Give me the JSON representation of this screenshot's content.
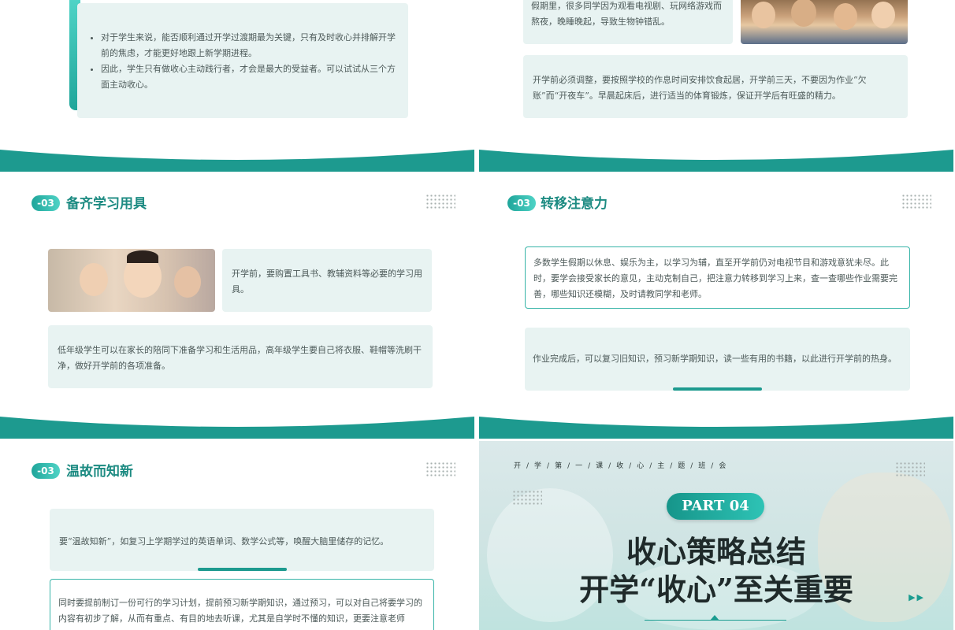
{
  "slide1": {
    "bullets": [
      "对于学生来说，能否顺利通过开学过渡期最为关键，只有及时收心并排解开学前的焦虑，才能更好地跟上新学期进程。",
      "因此，学生只有做收心主动践行者，才会是最大的受益者。可以试试从三个方面主动收心。"
    ]
  },
  "slide2": {
    "top_text": "假期里，很多同学因为观看电视剧、玩网络游戏而熬夜，晚睡晚起，导致生物钟错乱。",
    "card_text": "开学前必须调整，要按照学校的作息时间安排饮食起居，开学前三天，不要因为作业“欠账”而“开夜车”。早晨起床后，进行适当的体育锻炼，保证开学后有旺盛的精力。"
  },
  "slide3": {
    "badge": "-03",
    "title": "备齐学习用具",
    "card1": "开学前，要购置工具书、教辅资料等必要的学习用具。",
    "card2": "低年级学生可以在家长的陪同下准备学习和生活用品，高年级学生要自己将衣服、鞋帽等洗刷干净，做好开学前的各项准备。"
  },
  "slide4": {
    "badge": "-03",
    "title": "转移注意力",
    "card1": "多数学生假期以休息、娱乐为主，以学习为辅，直至开学前仍对电视节目和游戏意犹未尽。此时，要学会接受家长的意见，主动克制自己，把注意力转移到学习上来，查一查哪些作业需要完善，哪些知识还模糊，及时请教同学和老师。",
    "card2": "作业完成后，可以复习旧知识，预习新学期知识，读一些有用的书籍，以此进行开学前的热身。"
  },
  "slide5": {
    "badge": "-03",
    "title": "温故而知新",
    "card1": "要“温故知新”，如复习上学期学过的英语单词、数学公式等，唤醒大脑里储存的记忆。",
    "card2": "同时要提前制订一份可行的学习计划，提前预习新学期知识，通过预习，可以对自己将要学习的内容有初步了解，从而有重点、有目的地去听课，尤其是自学时不懂的知识，更要注意老师"
  },
  "slide6": {
    "topline": "开/学/第/一/课/收/心/主/题/班/会",
    "part": "PART 04",
    "title1": "收心策略总结",
    "title2": "开学“收心”至关重要",
    "arrows": "▶▶"
  },
  "colors": {
    "teal": "#1d9a8f",
    "teal_light": "#4fd3c6",
    "card_bg": "#e8f3f2",
    "title_text": "#1d8b82"
  }
}
